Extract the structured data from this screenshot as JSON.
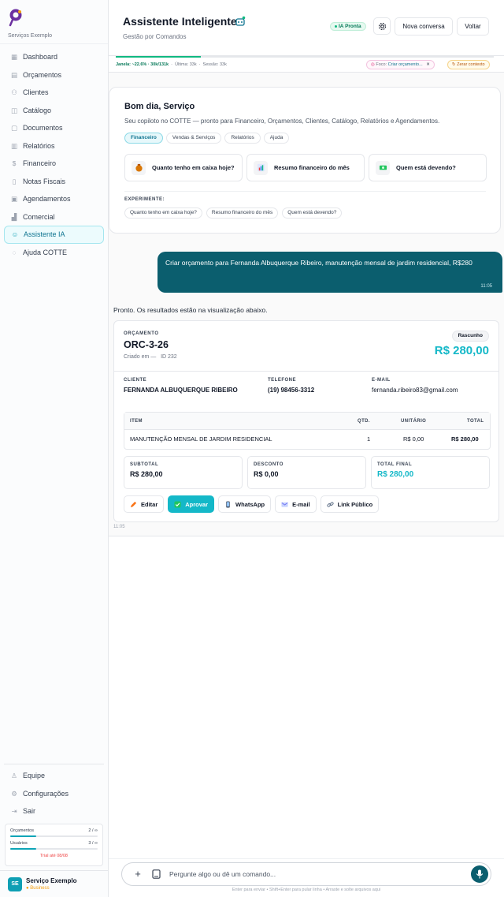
{
  "brand": {
    "company": "Serviços Exemplo"
  },
  "sidebar": {
    "items": [
      {
        "label": "Dashboard",
        "icon": "grid-icon"
      },
      {
        "label": "Orçamentos",
        "icon": "document-icon"
      },
      {
        "label": "Clientes",
        "icon": "users-icon"
      },
      {
        "label": "Catálogo",
        "icon": "box-icon"
      },
      {
        "label": "Documentos",
        "icon": "file-icon"
      },
      {
        "label": "Relatórios",
        "icon": "bar-chart-icon"
      },
      {
        "label": "Financeiro",
        "icon": "dollar-icon"
      },
      {
        "label": "Notas Fiscais",
        "icon": "receipt-icon"
      },
      {
        "label": "Agendamentos",
        "icon": "calendar-icon"
      },
      {
        "label": "Comercial",
        "icon": "trend-icon"
      },
      {
        "label": "Assistente IA",
        "icon": "smile-icon",
        "active": true
      },
      {
        "label": "Ajuda COTTE",
        "icon": "help-icon"
      }
    ],
    "bottom_items": [
      {
        "label": "Equipe",
        "icon": "person-icon"
      },
      {
        "label": "Configurações",
        "icon": "gear-icon"
      },
      {
        "label": "Sair",
        "icon": "logout-icon"
      }
    ],
    "usage": {
      "quotes_label": "Orçamentos",
      "quotes_value": "2 / ∞",
      "quotes_fraction": 0.3,
      "users_label": "Usuários",
      "users_value": "3 / ∞",
      "users_fraction": 0.3,
      "trial": "Trial até 08/08"
    },
    "user": {
      "initials": "SE",
      "name": "Serviço Exemplo",
      "plan": "Business"
    }
  },
  "header": {
    "title": "Assistente Inteligente",
    "subtitle": "Gestão por Comandos",
    "status": "IA Pronta",
    "new_chat": "Nova conversa",
    "back": "Voltar"
  },
  "context": {
    "window": "Janela: ~22.6% · 30k/131k",
    "last": "Última: 33k",
    "session": "Sessão: 33k",
    "window_fraction": 0.226,
    "focus_label": "Foco:",
    "focus_value": "Criar orçamento...",
    "reset": "Zerar contexto"
  },
  "welcome": {
    "greeting": "Bom dia, Serviço",
    "subtitle": "Seu copiloto no COTTE — pronto para Financeiro, Orçamentos, Clientes, Catálogo, Relatórios e Agendamentos.",
    "tabs": [
      "Financeiro",
      "Vendas & Serviços",
      "Relatórios",
      "Ajuda"
    ],
    "cards": [
      "Quanto tenho em caixa hoje?",
      "Resumo financeiro do mês",
      "Quem está devendo?"
    ],
    "try_label": "EXPERIMENTE:",
    "chips": [
      "Quanto tenho em caixa hoje?",
      "Resumo financeiro do mês",
      "Quem está devendo?"
    ]
  },
  "messages": {
    "user_text": "Criar orçamento para Fernanda Albuquerque Ribeiro, manutenção mensal de jardim residencial, R$280",
    "user_time": "11:05",
    "assistant_text": "Pronto. Os resultados estão na visualização abaixo.",
    "assistant_time": "11:05"
  },
  "quote": {
    "label": "ORÇAMENTO",
    "number": "ORC-3-26",
    "created": "Criado em —",
    "id": "ID 232",
    "status": "Rascunho",
    "total": "R$ 280,00",
    "client_label": "CLIENTE",
    "client": "FERNANDA ALBUQUERQUE RIBEIRO",
    "phone_label": "TELEFONE",
    "phone": "(19) 98456-3312",
    "email_label": "E-MAIL",
    "email": "fernanda.ribeiro83@gmail.com",
    "columns": {
      "item": "ITEM",
      "qty": "QTD.",
      "unit": "UNITÁRIO",
      "total": "TOTAL"
    },
    "row": {
      "item": "MANUTENÇÃO MENSAL DE JARDIM RESIDENCIAL",
      "qty": "1",
      "unit": "R$ 0,00",
      "total": "R$ 280,00"
    },
    "subtotal_label": "SUBTOTAL",
    "subtotal": "R$ 280,00",
    "discount_label": "DESCONTO",
    "discount": "R$ 0,00",
    "final_label": "TOTAL FINAL",
    "final": "R$ 280,00",
    "actions": {
      "edit": "Editar",
      "approve": "Aprovar",
      "whatsapp": "WhatsApp",
      "email": "E-mail",
      "public_link": "Link Público"
    }
  },
  "composer": {
    "placeholder": "Pergunte algo ou dê um comando...",
    "hint": "Enter para enviar • Shift+Enter para pular linha • Arraste e solte arquivos aqui"
  },
  "colors": {
    "accent": "#14b8c8",
    "dark_teal": "#0b5e6e",
    "success": "#10b981"
  }
}
